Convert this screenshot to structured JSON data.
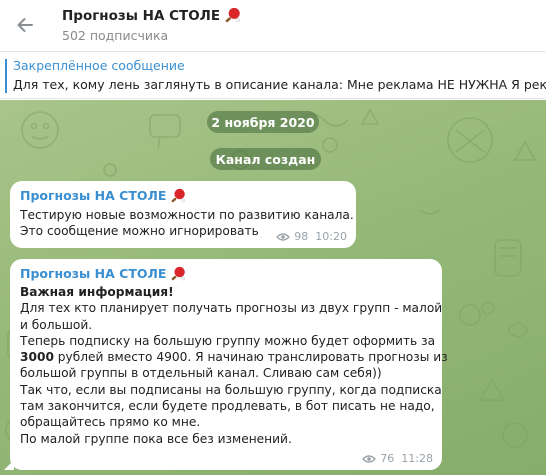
{
  "header": {
    "title": "Прогнозы НА СТОЛЕ",
    "subscribers": "502 подписчика"
  },
  "pinned": {
    "label": "Закреплённое сообщение",
    "text": "Для тех, кому лень заглянуть в описание канала:  Мне реклама НЕ НУЖНА Я рекламу"
  },
  "service": {
    "date": "2 ноября 2020",
    "created": "Канал создан"
  },
  "messages": [
    {
      "sender": "Прогнозы НА СТОЛЕ",
      "lines": [
        "Тестирую новые возможности по развитию канала.",
        "Это сообщение можно игнорировать"
      ],
      "views": "98",
      "time": "10:20"
    },
    {
      "sender": "Прогнозы НА СТОЛЕ",
      "heading": "Важная информация!",
      "lines": [
        "Для тех кто планирует получать прогнозы из двух групп - малой",
        "и большой.",
        "Теперь подписку на большую группу можно будет оформить за",
        "3000",
        " рублей вместо 4900. Я начинаю транслировать прогнозы из",
        "большой группы в отдельный канал. Сливаю сам себя))",
        " Так что, если вы подписаны на большую группу, когда подписка",
        "там закончится, если будете продлевать, в бот писать не надо,",
        "обращайтесь прямо ко мне.",
        "По малой группе пока все без изменений."
      ],
      "views": "76",
      "time": "11:28"
    }
  ],
  "icons": {
    "back": "arrow-left-icon",
    "emoji": "ping-pong-paddle-icon",
    "views": "eye-icon"
  },
  "colors": {
    "accent": "#3a8fd0",
    "paddle": "#d8262b"
  }
}
